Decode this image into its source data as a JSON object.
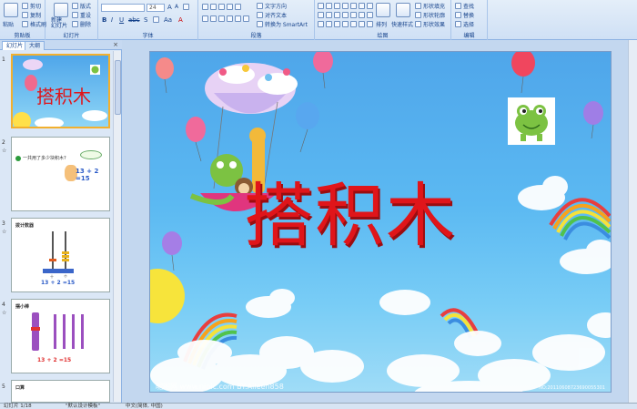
{
  "ribbon": {
    "clipboard": {
      "paste": "粘贴",
      "cut": "剪切",
      "copy": "复制",
      "format_painter": "格式刷",
      "group_label": "剪贴板"
    },
    "slides": {
      "new_slide": "新建\n幻灯片",
      "layout": "版式",
      "reset": "重设",
      "delete": "删除",
      "group_label": "幻灯片"
    },
    "font": {
      "font_size": "24",
      "group_label": "字体"
    },
    "paragraph": {
      "text_direction": "文字方向",
      "align_text": "对齐文本",
      "convert_smartart": "转换为 SmartArt",
      "group_label": "段落"
    },
    "drawing": {
      "arrange": "排列",
      "quick_styles": "快速样式",
      "shape_fill": "形状填充",
      "shape_outline": "形状轮廓",
      "shape_effects": "形状效果",
      "group_label": "绘图"
    },
    "editing": {
      "find": "查找",
      "replace": "替换",
      "select": "选择",
      "group_label": "编辑"
    }
  },
  "panel": {
    "tabs": [
      "幻灯片",
      "大纲"
    ],
    "close": "×",
    "slides": [
      {
        "num": "1",
        "title": "搭积木"
      },
      {
        "num": "2",
        "caption": "一共用了多少块积木?",
        "equation": "13 + 2 =15"
      },
      {
        "num": "3",
        "caption": "拨计数器",
        "labels": [
          "十",
          "个"
        ],
        "equation": "13 + 2 =15"
      },
      {
        "num": "4",
        "caption": "摆小棒",
        "equation": "13 + 2 =15"
      },
      {
        "num": "5",
        "caption": "口算"
      }
    ]
  },
  "slide": {
    "title": "搭积木",
    "watermark_left": "昵图网 www.nipic.com  BY:Aileen858",
    "watermark_right": "NO:20110608723690055301",
    "colors": {
      "title": "#e0151a",
      "sky_top": "#4fa6ea",
      "sky_bottom": "#9fdcf7"
    }
  },
  "status": {
    "slide_info": "幻灯片 1/18",
    "theme": "\"默认设计模板\"",
    "language": "中文(简体, 中国)"
  }
}
